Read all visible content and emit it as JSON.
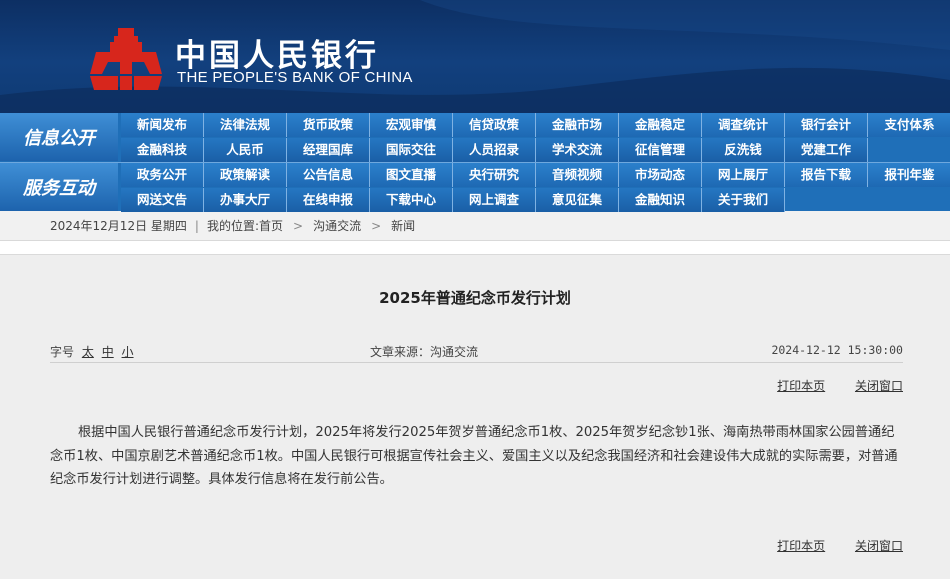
{
  "header": {
    "name_cn": "中国人民银行",
    "name_en": "THE PEOPLE'S BANK OF CHINA",
    "colors": {
      "bg": "#12407e",
      "logo": "#d7261c"
    }
  },
  "nav": {
    "info_label": "信息公开",
    "service_label": "服务互动",
    "rows": [
      [
        "新闻发布",
        "法律法规",
        "货币政策",
        "宏观审慎",
        "信贷政策",
        "金融市场",
        "金融稳定",
        "调查统计",
        "银行会计",
        "支付体系"
      ],
      [
        "金融科技",
        "人民币",
        "经理国库",
        "国际交往",
        "人员招录",
        "学术交流",
        "征信管理",
        "反洗钱",
        "党建工作",
        ""
      ],
      [
        "政务公开",
        "政策解读",
        "公告信息",
        "图文直播",
        "央行研究",
        "音频视频",
        "市场动态",
        "网上展厅",
        "报告下载",
        "报刊年鉴"
      ],
      [
        "网送文告",
        "办事大厅",
        "在线申报",
        "下载中心",
        "网上调查",
        "意见征集",
        "金融知识",
        "关于我们",
        "",
        ""
      ]
    ]
  },
  "breadcrumb": {
    "date": "2024年12月12日 星期四",
    "location_label": "我的位置:",
    "home": "首页",
    "section": "沟通交流",
    "current": "新闻"
  },
  "article": {
    "title": "2025年普通纪念币发行计划",
    "font_size_label": "字号",
    "font_sizes": [
      "太",
      "中",
      "小"
    ],
    "source": "文章来源：沟通交流",
    "time": "2024-12-12 15:30:00",
    "print_label": "打印本页",
    "close_label": "关闭窗口",
    "body": "根据中国人民银行普通纪念币发行计划，2025年将发行2025年贺岁普通纪念币1枚、2025年贺岁纪念钞1张、海南热带雨林国家公园普通纪念币1枚、中国京剧艺术普通纪念币1枚。中国人民银行可根据宣传社会主义、爱国主义以及纪念我国经济和社会建设伟大成就的实际需要，对普通纪念币发行计划进行调整。具体发行信息将在发行前公告。"
  }
}
